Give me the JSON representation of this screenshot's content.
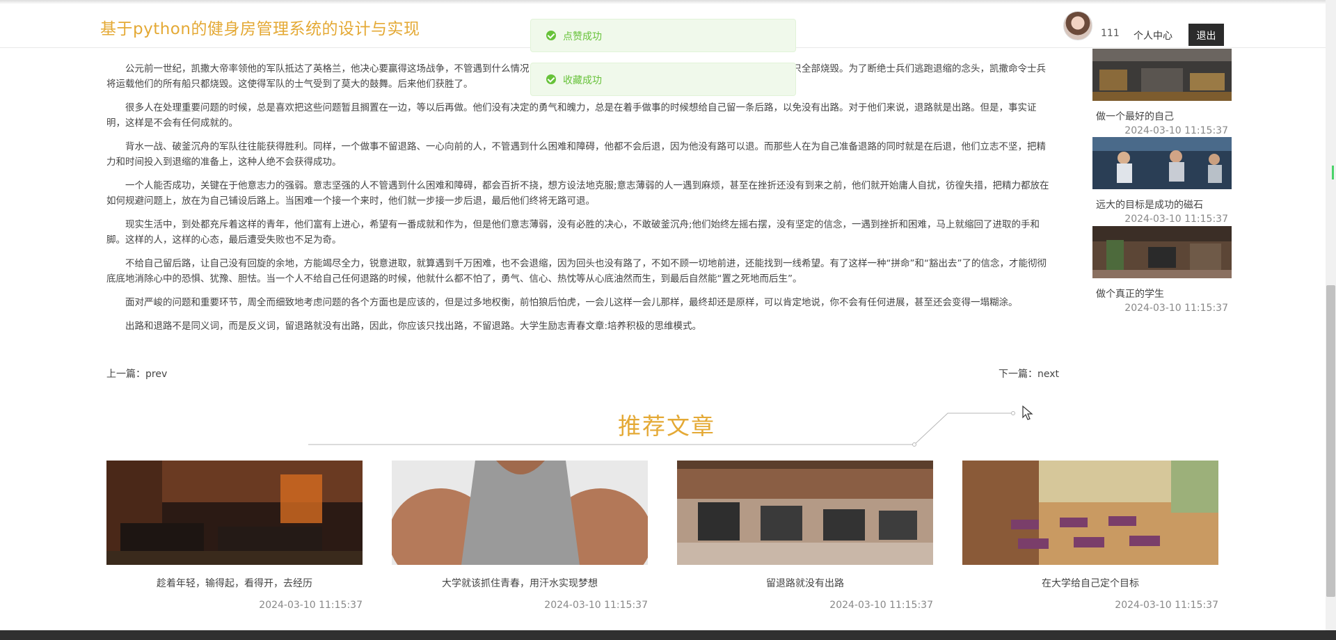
{
  "header": {
    "site_title": "基于python的健身房管理系统的设计与实现",
    "username": "111",
    "personal_center": "个人中心",
    "logout": "退出"
  },
  "toasts": [
    {
      "message": "点赞成功"
    },
    {
      "message": "收藏成功"
    }
  ],
  "article": {
    "paragraphs": [
      "公元前一世纪，凯撒大帝率领他的军队抵达了英格兰，他决心要赢得这场战争，不管遇到什么情况，都绝对不能后退。为了表示他的决心，他下令将运载他们的船只全部烧毁。为了断绝士兵们逃跑退缩的念头，凯撒命令士兵将运载他们的所有船只都烧毁。这使得军队的士气受到了莫大的鼓舞。后来他们获胜了。",
      "很多人在处理重要问题的时候，总是喜欢把这些问题暂且搁置在一边，等以后再做。他们没有决定的勇气和魄力，总是在着手做事的时候想给自己留一条后路，以免没有出路。对于他们来说，退路就是出路。但是，事实证明，这样是不会有任何成就的。",
      "背水一战、破釜沉舟的军队往往能获得胜利。同样，一个做事不留退路、一心向前的人，不管遇到什么困难和障碍，他都不会后退，因为他没有路可以退。而那些人在为自己准备退路的同时就是在后退，他们立志不坚，把精力和时间投入到退缩的准备上，这种人绝不会获得成功。",
      "一个人能否成功，关键在于他意志力的强弱。意志坚强的人不管遇到什么困难和障碍，都会百折不挠，想方设法地克服;意志薄弱的人一遇到麻烦，甚至在挫折还没有到来之前，他们就开始庸人自扰，彷徨失措，把精力都放在如何规避问题上，放在为自己铺设后路上。当困难一个接一个来时，他们就一步接一步后退，最后他们终将无路可退。",
      "现实生活中，到处都充斥着这样的青年，他们富有上进心，希望有一番成就和作为，但是他们意志薄弱，没有必胜的决心，不敢破釜沉舟;他们始终左摇右摆，没有坚定的信念，一遇到挫折和困难，马上就缩回了进取的手和脚。这样的人，这样的心态，最后遭受失败也不足为奇。",
      "不给自己留后路，让自己没有回旋的余地，方能竭尽全力，锐意进取，就算遇到千万困难，也不会退缩，因为回头也没有路了，不如不顾一切地前进，还能找到一线希望。有了这样一种“拼命”和“豁出去”了的信念，才能彻彻底底地消除心中的恐惧、犹豫、胆怯。当一个人不给自己任何退路的时候，他就什么都不怕了，勇气、信心、热忱等从心底油然而生，到最后自然能“置之死地而后生”。",
      "面对严峻的问题和重要环节，周全而细致地考虑问题的各个方面也是应该的，但是过多地权衡，前怕狼后怕虎，一会儿这样一会儿那样，最终却还是原样，可以肯定地说，你不会有任何进展，甚至还会变得一塌糊涂。",
      "出路和退路不是同义词，而是反义词，留退路就没有出路，因此，你应该只找出路，不留退路。大学生励志青春文章:培养积极的思维模式。"
    ],
    "prev": "上一篇：prev",
    "next": "下一篇：next"
  },
  "sidebar": {
    "items": [
      {
        "title": "做一个最好的自己",
        "date": "2024-03-10 11:15:37"
      },
      {
        "title": "远大的目标是成功的磁石",
        "date": "2024-03-10 11:15:37"
      },
      {
        "title": "做个真正的学生",
        "date": "2024-03-10 11:15:37"
      }
    ]
  },
  "recommend": {
    "title": "推荐文章",
    "items": [
      {
        "title": "趁着年轻，输得起，看得开，去经历",
        "date": "2024-03-10 11:15:37"
      },
      {
        "title": "大学就该抓住青春，用汗水实现梦想",
        "date": "2024-03-10 11:15:37"
      },
      {
        "title": "留退路就没有出路",
        "date": "2024-03-10 11:15:37"
      },
      {
        "title": "在大学给自己定个目标",
        "date": "2024-03-10 11:15:37"
      }
    ]
  },
  "colors": {
    "accent": "#e4a935",
    "success": "#67c23a",
    "logout_bg": "#2b2b2b"
  }
}
